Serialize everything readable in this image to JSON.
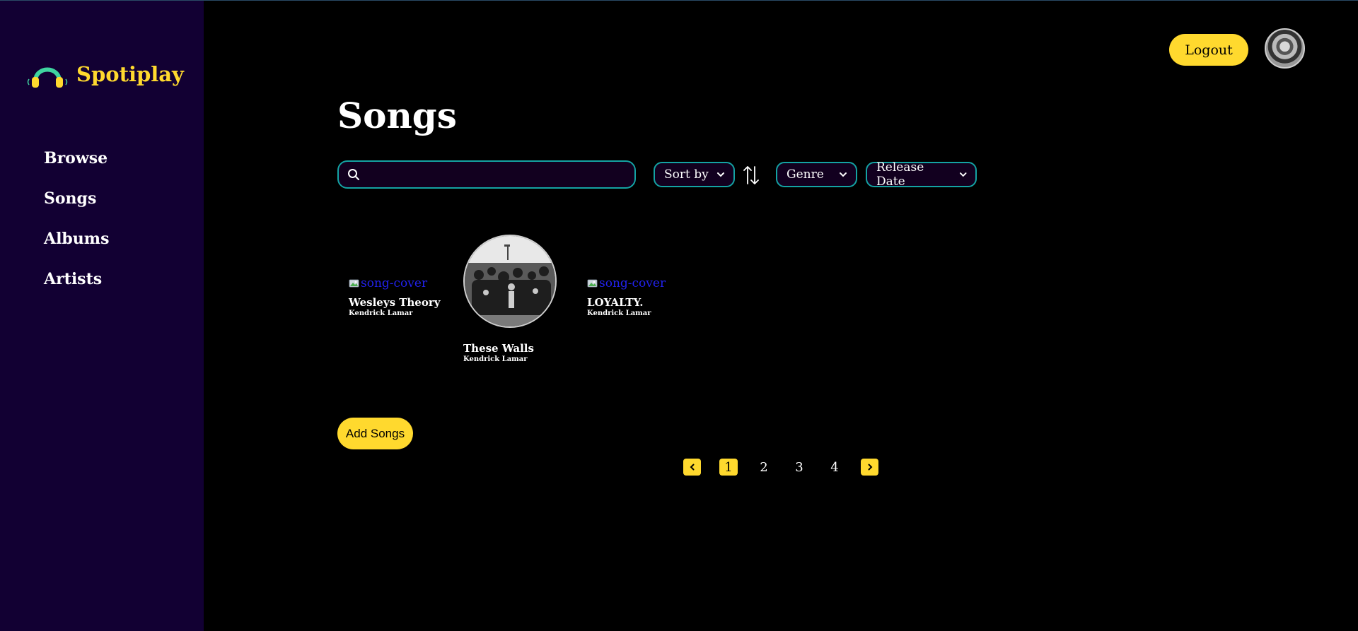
{
  "brand": {
    "name": "Spotiplay",
    "icon": "headphones-icon"
  },
  "sidebar": {
    "items": [
      {
        "label": "Browse"
      },
      {
        "label": "Songs"
      },
      {
        "label": "Albums"
      },
      {
        "label": "Artists"
      }
    ]
  },
  "header": {
    "logout_label": "Logout",
    "avatar": "user-avatar"
  },
  "main": {
    "title": "Songs",
    "search": {
      "value": "",
      "placeholder": ""
    },
    "sort_label": "Sort by",
    "genre_label": "Genre",
    "release_label": "Release Date"
  },
  "songs": [
    {
      "title": "Wesleys Theory",
      "artist": "Kendrick Lamar",
      "cover_alt": "song-cover",
      "cover_loaded": false
    },
    {
      "title": "These Walls",
      "artist": "Kendrick Lamar",
      "cover_alt": "song-cover",
      "cover_loaded": true
    },
    {
      "title": "LOYALTY.",
      "artist": "Kendrick Lamar",
      "cover_alt": "song-cover",
      "cover_loaded": false
    }
  ],
  "add_songs_label": "Add Songs",
  "pagination": {
    "pages": [
      "1",
      "2",
      "3",
      "4"
    ],
    "current": "1"
  },
  "colors": {
    "accent": "#ffd92e",
    "sidebar": "#120033",
    "border": "#14a3a3",
    "background": "#000000"
  }
}
